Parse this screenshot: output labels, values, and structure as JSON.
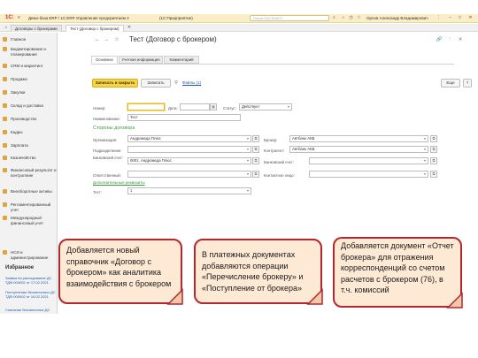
{
  "titlebar": {
    "logo": "1С:",
    "app_title": "Демо-база ERP / 1С:ERP Управление предприятием 2",
    "platform": "(1С:Предприятие)",
    "search_placeholder": "Поиск Ctrl+Shift+F",
    "user": "Орлов Александр Владимирович"
  },
  "tabs": {
    "items": [
      "Договоры с брокерами",
      "Тест (Договор с брокером)"
    ]
  },
  "sidebar": {
    "items": [
      "Главное",
      "Бюджетирование и планирование",
      "CRM и маркетинг",
      "Продажи",
      "Закупки",
      "Склад и доставка",
      "Производство",
      "Кадры",
      "Зарплата",
      "Казначейство",
      "Финансовый результат и контроллинг",
      "Внеоборотные активы",
      "Регламентированный учет",
      "Международный финансовый учет",
      "НСИ и администрирование"
    ],
    "favorites_title": "Избранное",
    "favorites": [
      "Заявка на расходование ДС ТДФ-000002 от 17.02.2021",
      "Поступление безналичных ДС ТДФ-000002 от 16.02.2021",
      "Списание безналичных ДС"
    ]
  },
  "form": {
    "title": "Тест (Договор с брокером)",
    "btn_save_close": "Записать и закрыть",
    "btn_save": "Записать",
    "files_link": "Файлы (1)",
    "btn_more": "Еще",
    "btn_help": "?",
    "tabs": [
      "Основное",
      "Учетная информация",
      "Комментарий"
    ],
    "labels": {
      "number": "Номер:",
      "date": "Дата:",
      "status": "Статус:",
      "name": "Наименование:",
      "organization": "Организация:",
      "department": "Подразделение:",
      "bank_account": "Банковский счет:",
      "responsible": "Ответственный:",
      "broker": "Брокер:",
      "counterparty": "Контрагент:",
      "broker_bank_account": "Банковский счет:",
      "contact_person": "Контактное лицо:",
      "test": "Тест:"
    },
    "values": {
      "number": "",
      "date": "",
      "status": "Действует",
      "name": "Тест",
      "organization": "Андромеда Плюс",
      "department": "",
      "bank_account": "0001, Андромеда Плюс",
      "responsible": "",
      "broker": "Автбанк АКБ",
      "counterparty": "Автбанк АКБ",
      "broker_bank_account": "",
      "contact_person": "",
      "test": "1"
    },
    "section_parties": "Стороны договора",
    "section_extra": "Дополнительные реквизиты"
  },
  "callouts": [
    "Добавляется новый справочник «Договор с брокером» как аналитика взаимодействия с брокером",
    "В платежных документах добавляются операции «Перечисление брокеру» и «Поступление от брокера»",
    "Добавляется документ «Отчет брокера» для отражения корреспонденций со счетом расчетов с брокером (76), в т.ч. комиссий"
  ],
  "colors": {
    "accent": "#fad43e",
    "callout_fill": "#fde9d4",
    "callout_border": "#b5272f",
    "section_green": "#3f9a3f",
    "link_blue": "#1f5aa8"
  }
}
